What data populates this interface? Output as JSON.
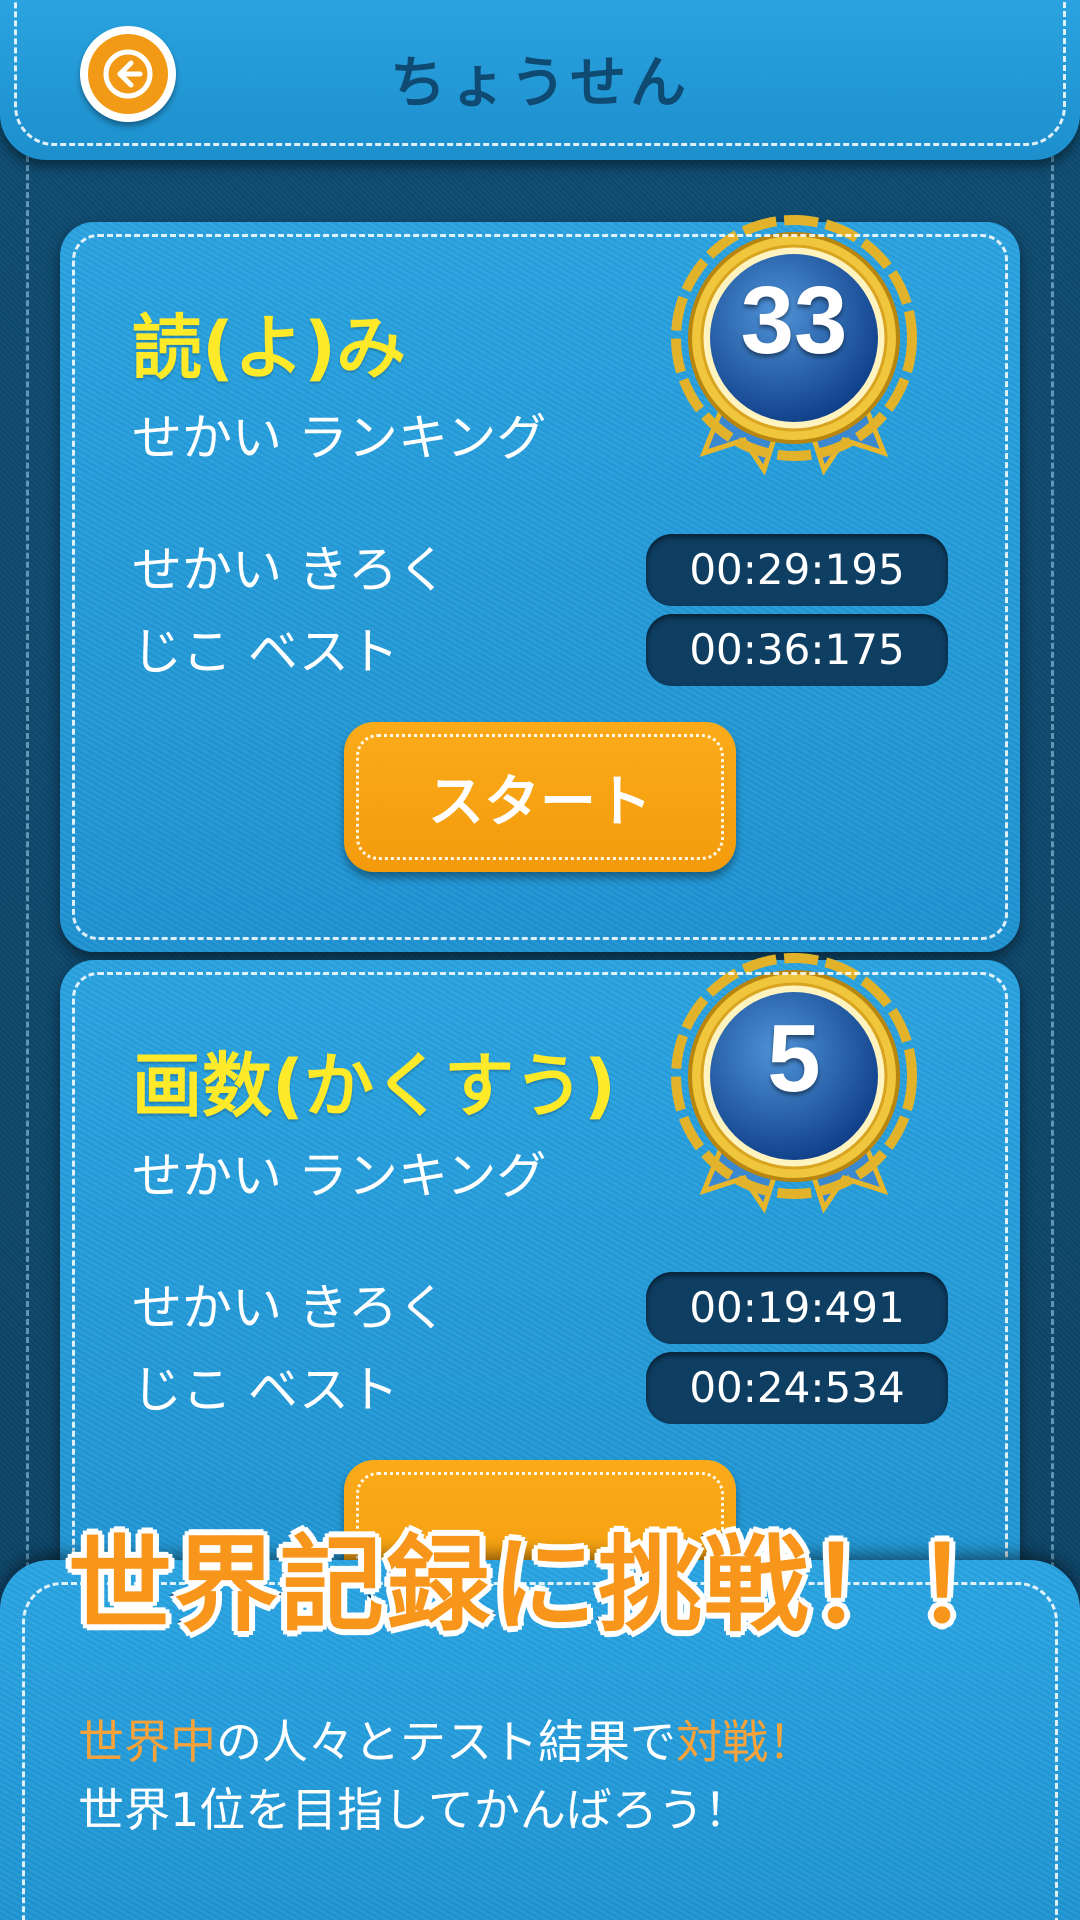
{
  "header": {
    "title": "ちょうせん",
    "back_icon": "back-arrow-icon"
  },
  "cards": [
    {
      "title": "読(よ)み",
      "ranking_label": "せかい ランキング",
      "rank": "33",
      "world_record_label": "せかい きろく",
      "world_record": "00:29:195",
      "personal_best_label": "じこ ベスト",
      "personal_best": "00:36:175",
      "start_label": "スタート"
    },
    {
      "title": "画数(かくすう)",
      "ranking_label": "せかい ランキング",
      "rank": "5",
      "world_record_label": "せかい きろく",
      "world_record": "00:19:491",
      "personal_best_label": "じこ ベスト",
      "personal_best": "00:24:534"
    }
  ],
  "promo": {
    "headline": "世界記録に挑戦！！",
    "line1": {
      "a": "世界中",
      "b": "の人々とテスト結果で",
      "c": "対戦！"
    },
    "line2": "世界1位を目指してかんばろう！"
  },
  "colors": {
    "accent_orange": "#f39b0c",
    "title_yellow": "#ffea2a",
    "panel_blue": "#1f94d3",
    "dark_navy": "#0e3e62"
  }
}
